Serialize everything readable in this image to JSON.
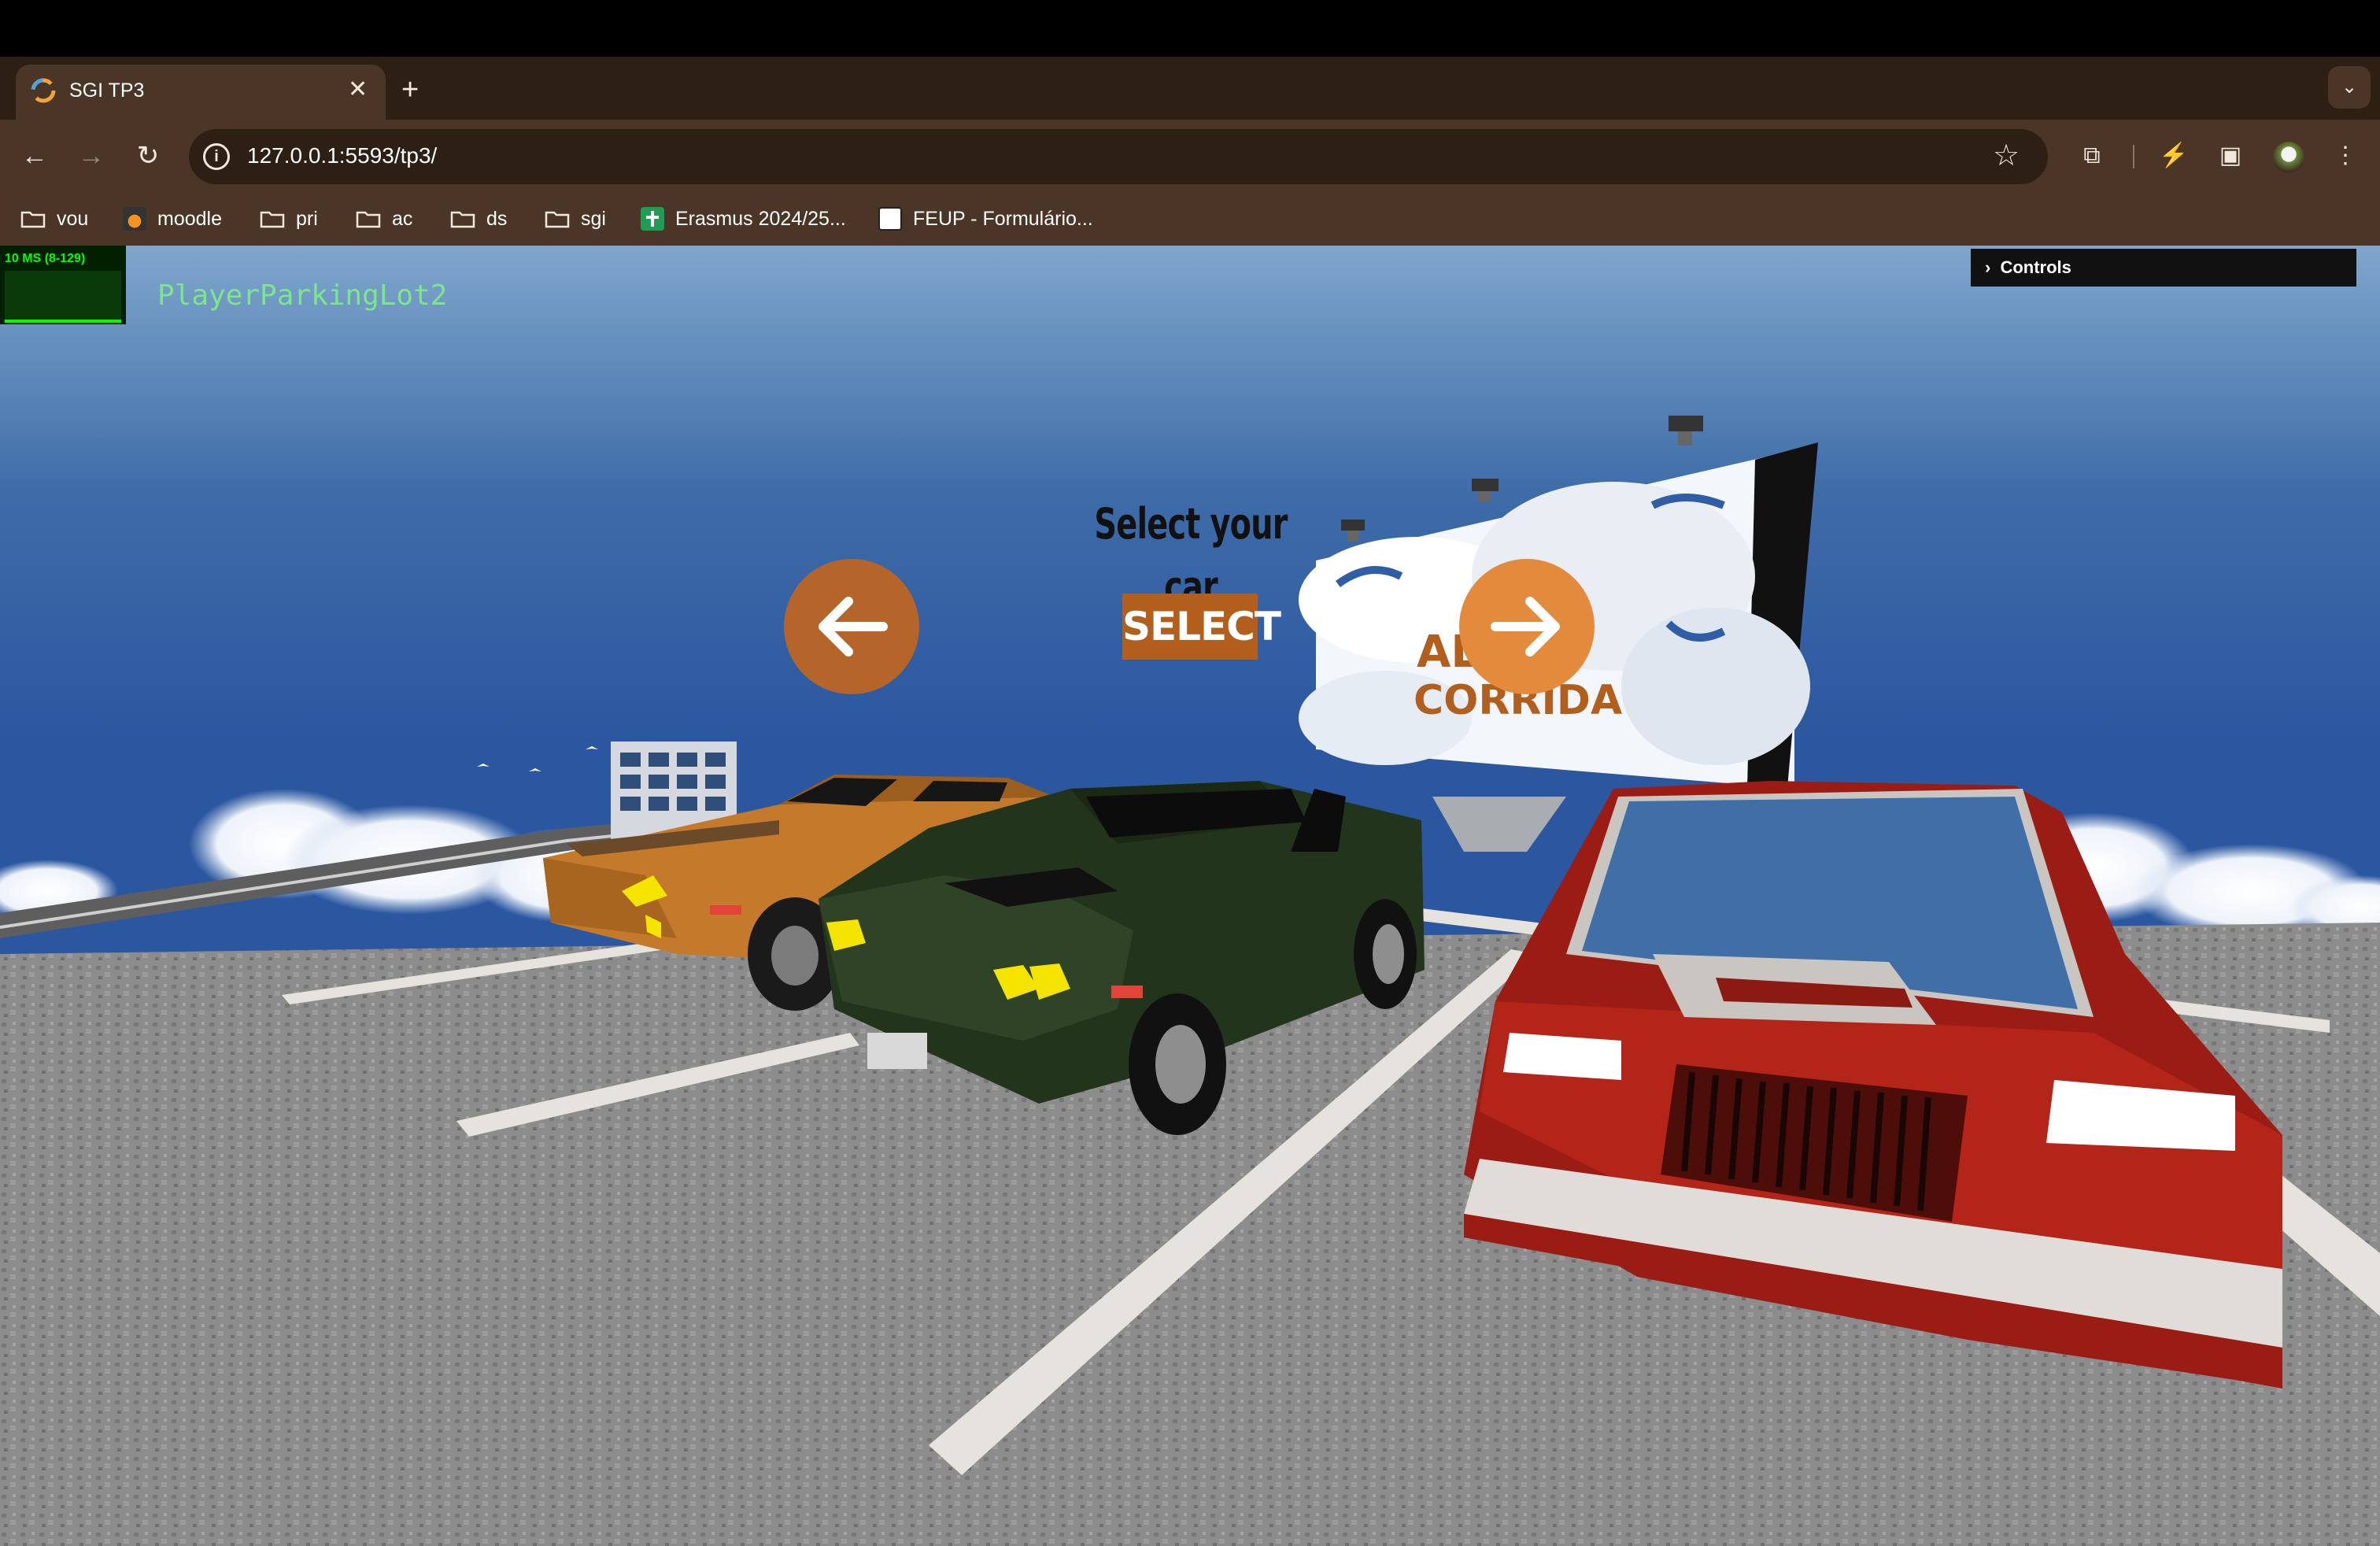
{
  "browser": {
    "tab_title": "SGI TP3",
    "close_glyph": "✕",
    "new_tab_glyph": "+",
    "tab_menu_glyph": "⌄",
    "url": "127.0.0.1:5593/tp3/",
    "back_glyph": "←",
    "forward_glyph": "→",
    "reload_glyph": "↻",
    "info_glyph": "i",
    "star_glyph": "☆",
    "extensions_glyph": "⧉",
    "performance_glyph": "⚡",
    "sidepanel_glyph": "▣",
    "menu_glyph": "⋮"
  },
  "bookmarks": [
    {
      "label": "vou",
      "icon": "folder-icon"
    },
    {
      "label": "moodle",
      "icon": "moodle-icon"
    },
    {
      "label": "pri",
      "icon": "folder-icon"
    },
    {
      "label": "ac",
      "icon": "folder-icon"
    },
    {
      "label": "ds",
      "icon": "folder-icon"
    },
    {
      "label": "sgi",
      "icon": "folder-icon"
    },
    {
      "label": "Erasmus 2024/25...",
      "icon": "green-doc-icon"
    },
    {
      "label": "FEUP - Formulário...",
      "icon": "feup-icon"
    }
  ],
  "stats": {
    "text": "10 MS (8-129)"
  },
  "scene": {
    "label": "PlayerParkingLot2"
  },
  "controls": {
    "label": "Controls",
    "glyph": "›"
  },
  "menu": {
    "title": "Select your car",
    "select_label": "SELECT",
    "billboard_text_1": "AL",
    "billboard_text_2": "CORRIDA"
  },
  "colors": {
    "accent_button": "#b25f1e",
    "arrow_left": "#b5652a",
    "arrow_right": "#e38a3c",
    "browser_frame": "#4a3527",
    "browser_tabstrip": "#2e1f14",
    "car_orange": "#c47a2a",
    "car_green": "#23341c",
    "car_red": "#9b1c14"
  }
}
